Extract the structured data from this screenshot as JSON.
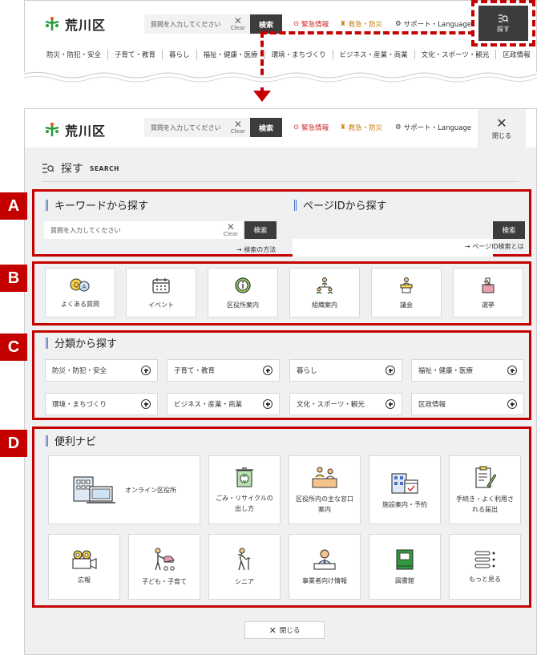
{
  "header": {
    "logo_text": "荒川区",
    "search_placeholder": "質問を入力してください",
    "clear_label": "Clear",
    "search_button": "検索",
    "links": {
      "emergency_info": "緊急情報",
      "disaster": "救急・防災",
      "support": "サポート・Language"
    },
    "search_tab_label": "探す",
    "nav": [
      "防災・防犯・安全",
      "子育て・教育",
      "暮らし",
      "福祉・健康・医療",
      "環境・まちづくり",
      "ビジネス・産業・商業",
      "文化・スポーツ・観光",
      "区政情報"
    ]
  },
  "modal": {
    "header": {
      "logo_text": "荒川区",
      "search_placeholder": "質問を入力してください",
      "clear_label": "Clear",
      "search_button": "検索",
      "emergency_info": "緊急情報",
      "disaster": "救急・防災",
      "support": "サポート・Language",
      "close_label": "閉じる"
    },
    "title": "探す",
    "title_en": "SEARCH",
    "labels": [
      "A",
      "B",
      "C",
      "D"
    ],
    "keyword": {
      "title": "キーワードから探す",
      "placeholder": "質問を入力してください",
      "clear_label": "Clear",
      "button": "検索",
      "link": "→ 検索の方法"
    },
    "pageid": {
      "title": "ページIDから探す",
      "button": "検索",
      "link": "→ ページID検索とは"
    },
    "quick": [
      "よくある質問",
      "イベント",
      "区役所案内",
      "組織案内",
      "議会",
      "選挙"
    ],
    "category": {
      "title": "分類から探す",
      "items": [
        "防災・防犯・安全",
        "子育て・教育",
        "暮らし",
        "福祉・健康・医療",
        "環境・まちづくり",
        "ビジネス・産業・商業",
        "文化・スポーツ・観光",
        "区政情報"
      ]
    },
    "navi": {
      "title": "便利ナビ",
      "online": "オンライン区役所",
      "items": [
        "ごみ・リサイクルの出し方",
        "区役所内の主な窓口案内",
        "施設案内・予約",
        "手続き・よく利用される届出",
        "広報",
        "子ども・子育て",
        "シニア",
        "事業者向け情報",
        "図書館",
        "もっと見る"
      ]
    },
    "close_bottom": "閉じる"
  },
  "colors": {
    "accent_red": "#c40000",
    "dark_button": "#3c3c3c",
    "logo_green": "#2e9a3e",
    "bar_blue": "#4a6fc9"
  }
}
